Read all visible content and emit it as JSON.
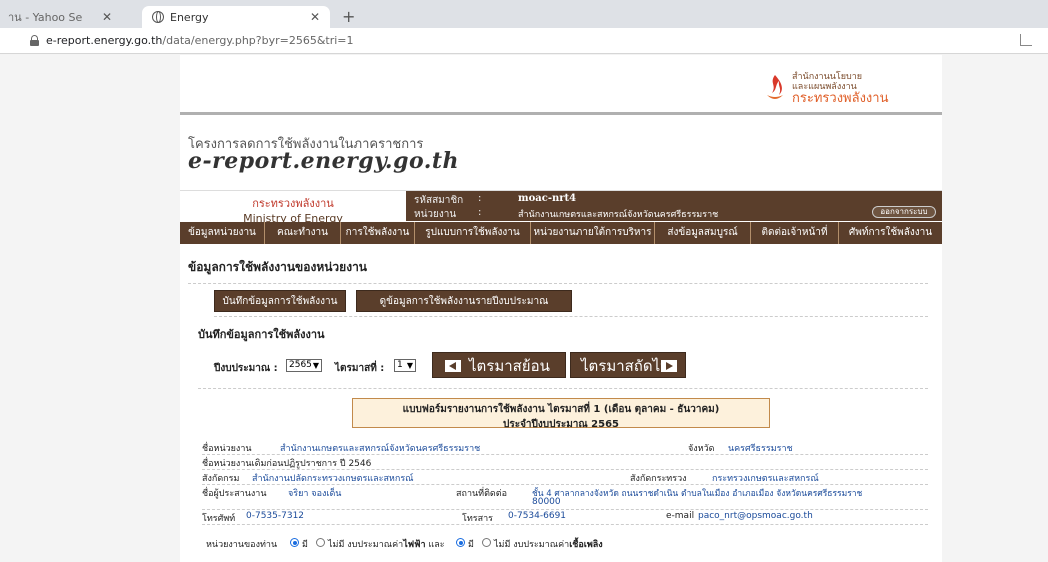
{
  "browser": {
    "tabs": [
      {
        "title": "าน - Yahoo Se",
        "active": false
      },
      {
        "title": "Energy",
        "active": true
      }
    ],
    "url_host": "e-report.energy.go.th",
    "url_path": "/data/energy.php?byr=2565&tri=1"
  },
  "header": {
    "logo_line1": "สำนักงานนโยบาย",
    "logo_line2": "และแผนพลังงาน",
    "logo_line3": "กระทรวงพลังงาน",
    "project_title": "โครงการลดการใช้พลังงานในภาคราชการ",
    "site_name": "e-report.energy.go.th"
  },
  "infobar": {
    "ministry_th": "กระทรวงพลังงาน",
    "ministry_en": "Ministry of Energy",
    "member_label": "รหัสสมาชิก",
    "member_value": "moac-nrt4",
    "agency_label": "หน่วยงาน",
    "agency_value": "สำนักงานเกษตรและสหกรณ์จังหวัดนครศรีธรรมราช",
    "colon": ":",
    "logout_label": "ออกจากระบบ"
  },
  "nav": [
    {
      "label": "ข้อมูลหน่วยงาน"
    },
    {
      "label": "คณะทำงาน"
    },
    {
      "label": "การใช้พลังงาน"
    },
    {
      "label": "รูปแบบการใช้พลังงาน"
    },
    {
      "label": "หน่วยงานภายใต้การบริหาร"
    },
    {
      "label": "ส่งข้อมูลสมบูรณ์"
    },
    {
      "label": "ติดต่อเจ้าหน้าที่"
    },
    {
      "label": "ศัพท์การใช้พลังงาน"
    }
  ],
  "main": {
    "section_title": "ข้อมูลการใช้พลังงานของหน่วยงาน",
    "record_button": "บันทึกข้อมูลการใช้พลังงาน",
    "view_button": "ดูข้อมูลการใช้พลังงานรายปีงบประมาณ",
    "subsection_title": "บันทึกข้อมูลการใช้พลังงาน",
    "year_label": "ปีงบประมาณ :",
    "year_value": "2565",
    "quarter_label": "ไตรมาสที่ :",
    "quarter_value": "1",
    "prev_button": "ไตรมาสย้อนหลัง",
    "next_button": "ไตรมาสถัดไป"
  },
  "form": {
    "title_line1": "แบบฟอร์มรายงานการใช้พลังงาน ไตรมาสที่ 1 (เดือน ตุลาคม - ธันวาคม)",
    "title_line2": "ประจำปีงบประมาณ 2565",
    "agency_name_label": "ชื่อหน่วยงาน",
    "agency_name_value": "สำนักงานเกษตรและสหกรณ์จังหวัดนครศรีธรรมราช",
    "province_label": "จังหวัด",
    "province_value": "นครศรีธรรมราช",
    "old_name_label": "ชื่อหน่วยงานเดิมก่อนปฏิรูปราชการ ปี 2546",
    "department_label": "สังกัดกรม",
    "department_value": "สำนักงานปลัดกระทรวงเกษตรและสหกรณ์",
    "ministry_label": "สังกัดกระทรวง",
    "ministry_value": "กระทรวงเกษตรและสหกรณ์",
    "coordinator_label": "ชื่อผู้ประสานงาน",
    "coordinator_value": "จริยา จองเด็น",
    "address_label": "สถานที่ติดต่อ",
    "address_value_1": "ชั้น 4 ศาลากลางจังหวัด ถนนราชดำเนิน ตำบลในเมือง อำเภอเมือง จังหวัดนครศรีธรรมราช",
    "address_value_2": "80000",
    "phone_label": "โทรศัพท์",
    "phone_value": "0-7535-7312",
    "fax_label": "โทรสาร",
    "fax_value": "0-7534-6691",
    "email_label": "e-mail",
    "email_value": "paco_nrt@opsmoac.go.th"
  },
  "budget": {
    "prefix": "หน่วยงานของท่าน",
    "yes": "มี",
    "no": "ไม่มี",
    "electric_text_a": "งบประมาณค่า",
    "electric_text_b": "ไฟฟ้า",
    "and": "และ",
    "fuel_text_a": "งบประมาณค่า",
    "fuel_text_b": "เชื้อเพลิง"
  }
}
